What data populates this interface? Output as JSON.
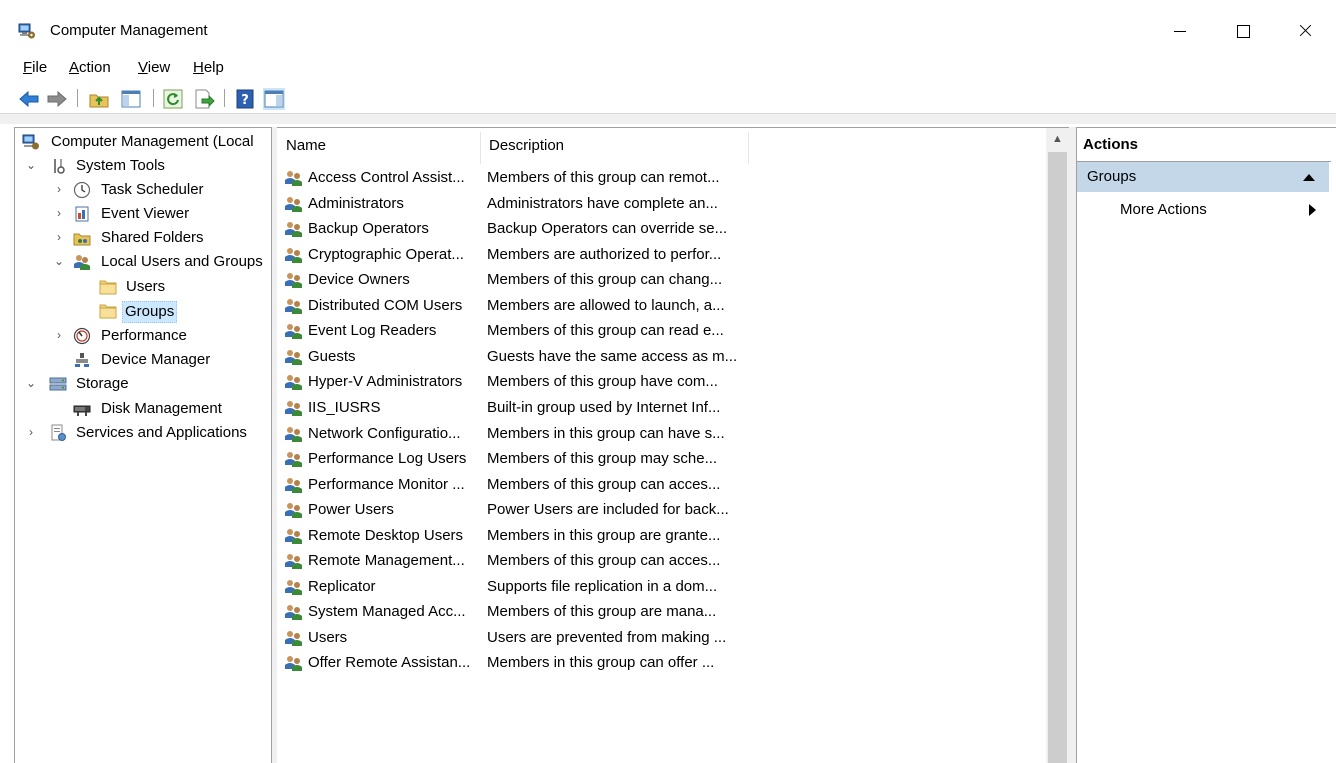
{
  "window": {
    "title": "Computer Management"
  },
  "menu": [
    {
      "id": "file",
      "label_ul": "F",
      "label_rest": "ile"
    },
    {
      "id": "action",
      "label_ul": "A",
      "label_rest": "ction"
    },
    {
      "id": "view",
      "label_ul": "V",
      "label_rest": "iew"
    },
    {
      "id": "help",
      "label_ul": "H",
      "label_rest": "elp"
    }
  ],
  "toolbar": {
    "buttons": [
      "back-icon",
      "forward-icon",
      "up-folder-icon",
      "show-hide-tree-icon",
      "refresh-icon",
      "export-list-icon",
      "help-icon",
      "show-hide-action-pane-icon"
    ]
  },
  "tree": {
    "root": "Computer Management (Local",
    "system_tools": "System Tools",
    "task_scheduler": "Task Scheduler",
    "event_viewer": "Event Viewer",
    "shared_folders": "Shared Folders",
    "local_users_groups": "Local Users and Groups",
    "users": "Users",
    "groups": "Groups",
    "performance": "Performance",
    "device_manager": "Device Manager",
    "storage": "Storage",
    "disk_management": "Disk Management",
    "services_apps": "Services and Applications",
    "selected": "Groups"
  },
  "list": {
    "columns": {
      "name": "Name",
      "description": "Description"
    },
    "rows": [
      {
        "name": "Access Control Assist...",
        "description": "Members of this group can remot..."
      },
      {
        "name": "Administrators",
        "description": "Administrators have complete an..."
      },
      {
        "name": "Backup Operators",
        "description": "Backup Operators can override se..."
      },
      {
        "name": "Cryptographic Operat...",
        "description": "Members are authorized to perfor..."
      },
      {
        "name": "Device Owners",
        "description": "Members of this group can chang..."
      },
      {
        "name": "Distributed COM Users",
        "description": "Members are allowed to launch, a..."
      },
      {
        "name": "Event Log Readers",
        "description": "Members of this group can read e..."
      },
      {
        "name": "Guests",
        "description": "Guests have the same access as m..."
      },
      {
        "name": "Hyper-V Administrators",
        "description": "Members of this group have com..."
      },
      {
        "name": "IIS_IUSRS",
        "description": "Built-in group used by Internet Inf..."
      },
      {
        "name": "Network Configuratio...",
        "description": "Members in this group can have s..."
      },
      {
        "name": "Performance Log Users",
        "description": "Members of this group may sche..."
      },
      {
        "name": "Performance Monitor ...",
        "description": "Members of this group can acces..."
      },
      {
        "name": "Power Users",
        "description": "Power Users are included for back..."
      },
      {
        "name": "Remote Desktop Users",
        "description": "Members in this group are grante..."
      },
      {
        "name": "Remote Management...",
        "description": "Members of this group can acces..."
      },
      {
        "name": "Replicator",
        "description": "Supports file replication in a dom..."
      },
      {
        "name": "System Managed Acc...",
        "description": "Members of this group are mana..."
      },
      {
        "name": "Users",
        "description": "Users are prevented from making ..."
      },
      {
        "name": "Offer Remote Assistan...",
        "description": "Members in this group can offer ..."
      }
    ]
  },
  "actions": {
    "title": "Actions",
    "group": "Groups",
    "more": "More Actions"
  },
  "colors": {
    "selection_bg": "#cce8ff",
    "actions_header_bg": "#c3d7e9",
    "border": "#a0a0a0"
  }
}
